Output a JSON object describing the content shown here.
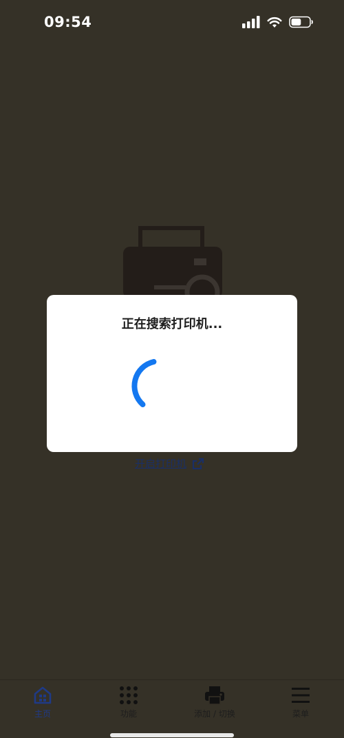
{
  "status_bar": {
    "time": "09:54",
    "battery_level": 0.55
  },
  "modal": {
    "title": "正在搜索打印机..."
  },
  "link": {
    "open_printer": "开启打印机"
  },
  "tabbar": {
    "items": [
      {
        "label": "主页",
        "icon": "home-icon",
        "active": true
      },
      {
        "label": "功能",
        "icon": "grid-icon",
        "active": false
      },
      {
        "label": "添加 / 切换",
        "icon": "printer-icon",
        "active": false
      },
      {
        "label": "菜单",
        "icon": "menu-icon",
        "active": false
      }
    ]
  },
  "colors": {
    "overlay_bg": "#353127",
    "accent_blue": "#1478f0",
    "tab_active": "#1f3a86",
    "link": "#1a2f66"
  }
}
